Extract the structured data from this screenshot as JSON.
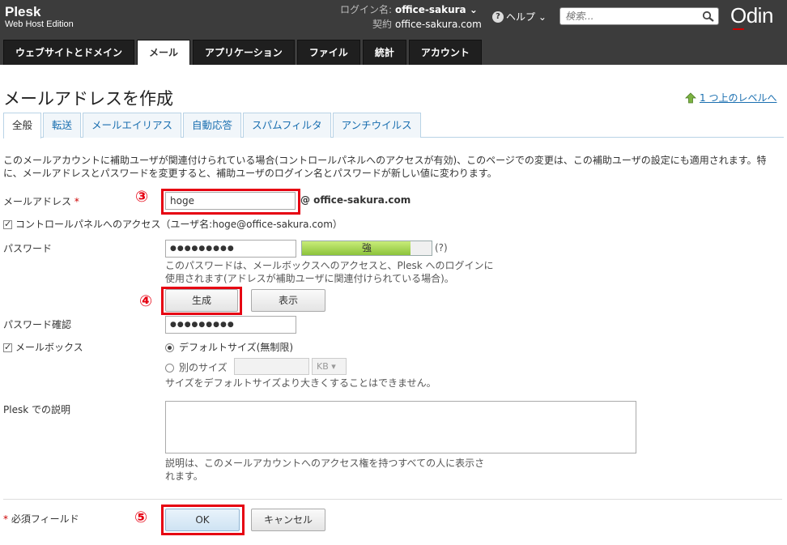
{
  "header": {
    "brand_line1": "Plesk",
    "brand_line2": "Web Host Edition",
    "login_label": "ログイン名:",
    "login_value": "office-sakura ⌄",
    "contract_label": "契約",
    "contract_value": "office-sakura.com",
    "help_label": "ヘルプ ⌄",
    "search_placeholder": "検索...",
    "logo_text": "Odin"
  },
  "nav": {
    "tabs": [
      "ウェブサイトとドメイン",
      "メール",
      "アプリケーション",
      "ファイル",
      "統計",
      "アカウント"
    ],
    "active_index": 1
  },
  "page": {
    "title": "メールアドレスを作成",
    "up_level_link": "1 つ上のレベルへ",
    "subtabs": [
      "全般",
      "転送",
      "メールエイリアス",
      "自動応答",
      "スパムフィルタ",
      "アンチウイルス"
    ],
    "notice": "このメールアカウントに補助ユーザが関連付けられている場合(コントロールパネルへのアクセスが有効)、このページでの変更は、この補助ユーザの設定にも適用されます。特に、メールアドレスとパスワードを変更すると、補助ユーザのログイン名とパスワードが新しい値に変わります。"
  },
  "form": {
    "email_label": "メールアドレス",
    "required_mark": "*",
    "email_value": "hoge",
    "domain_suffix": "@ office-sakura.com",
    "panel_access_label": "コントロールパネルへのアクセス",
    "panel_access_user": "（ユーザ名:hoge@office-sakura.com）",
    "password_label": "パスワード",
    "password_value": "●●●●●●●●●",
    "strength_label": "強",
    "strength_fraction": 0.84,
    "strength_help": "(?)",
    "password_hint_1": "このパスワードは、メールボックスへのアクセスと、Plesk へのログインに",
    "password_hint_2": "使用されます(アドレスが補助ユーザに関連付けられている場合)。",
    "generate_button": "生成",
    "show_button": "表示",
    "password_confirm_label": "パスワード確認",
    "password_confirm_value": "●●●●●●●●●",
    "mailbox_label": "メールボックス",
    "default_size_option": "デフォルトサイズ(無制限)",
    "other_size_option": "別のサイズ",
    "size_unit": "KB ▾",
    "size_hint": "サイズをデフォルトサイズより大きくすることはできません。",
    "description_label": "Plesk での説明",
    "description_hint_1": "説明は、このメールアカウントへのアクセス権を持つすべての人に表示さ",
    "description_hint_2": "れます。",
    "required_fields_label": "必須フィールド",
    "ok_button": "OK",
    "cancel_button": "キャンセル"
  },
  "annotations": {
    "step3": "③",
    "step4": "④",
    "step5": "⑤",
    "highlight_color": "#e60012"
  }
}
